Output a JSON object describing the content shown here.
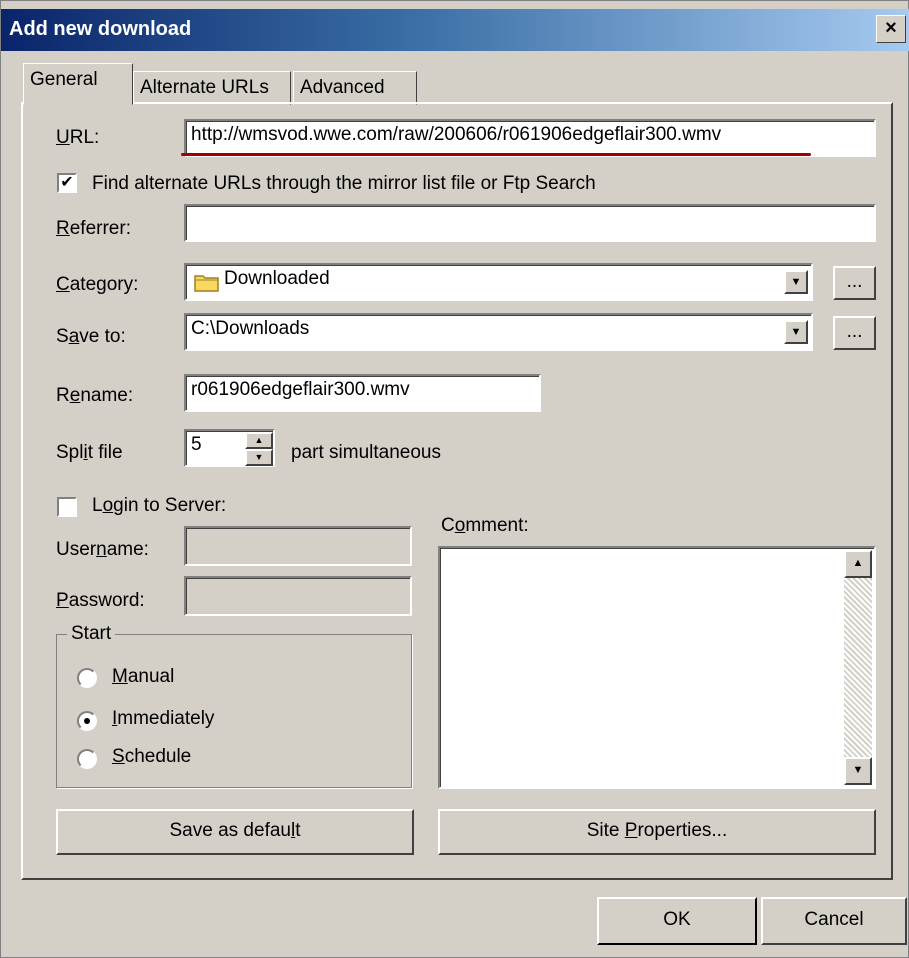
{
  "window": {
    "title": "Add new download",
    "close_label": "×"
  },
  "tabs": [
    {
      "label": "General",
      "active": true
    },
    {
      "label": "Alternate URLs",
      "active": false
    },
    {
      "label": "Advanced",
      "active": false
    }
  ],
  "url": {
    "label_ul": "U",
    "label_rest": "RL:",
    "value": "http://wmsvod.wwe.com/raw/200606/r061906edgeflair300.wmv"
  },
  "find_alternate": {
    "label": "Find alternate URLs through the mirror list file or Ftp Search",
    "checked": true
  },
  "referrer": {
    "label_ul": "R",
    "label_rest": "eferrer:",
    "value": ""
  },
  "category": {
    "label_ul": "C",
    "label_rest": "ategory:",
    "value": "Downloaded",
    "icon": "folder-icon"
  },
  "save_to": {
    "label_pre": "S",
    "label_ul": "a",
    "label_rest": "ve to:",
    "value": "C:\\Downloads"
  },
  "browse_label": "...",
  "rename": {
    "label_pre": "R",
    "label_ul": "e",
    "label_rest": "name:",
    "value": "r061906edgeflair300.wmv"
  },
  "split": {
    "label_pre": "Spl",
    "label_ul": "i",
    "label_rest": "t file",
    "value": "5",
    "suffix": "part simultaneous"
  },
  "login": {
    "label_pre": "L",
    "label_ul": "o",
    "label_rest": "gin to Server:",
    "checked": false
  },
  "username": {
    "label_pre": "User",
    "label_ul": "n",
    "label_rest": "ame:",
    "value": ""
  },
  "password": {
    "label_ul": "P",
    "label_rest": "assword:",
    "value": ""
  },
  "start": {
    "legend": "Start",
    "options": [
      {
        "ul": "M",
        "rest": "anual",
        "selected": false
      },
      {
        "ul": "I",
        "rest": "mmediately",
        "selected": true
      },
      {
        "ul": "S",
        "rest": "chedule",
        "selected": false
      }
    ]
  },
  "comment": {
    "label_pre": "C",
    "label_ul": "o",
    "label_rest": "mment:",
    "value": ""
  },
  "buttons": {
    "save_default_pre": "Save as defau",
    "save_default_ul": "l",
    "save_default_rest": "t",
    "site_pre": "Site ",
    "site_ul": "P",
    "site_rest": "roperties...",
    "ok": "OK",
    "cancel": "Cancel"
  },
  "colors": {
    "face": "#d4d0c8",
    "title_start": "#0a246a",
    "title_end": "#a6caf0",
    "url_underline": "#a00000"
  }
}
